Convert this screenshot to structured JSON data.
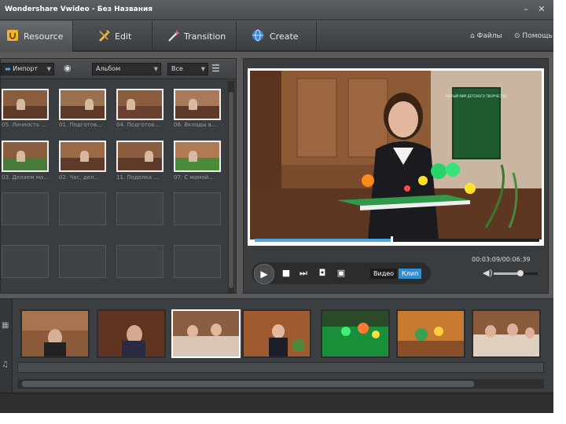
{
  "window": {
    "title": "Wondershare Vwideo - Без Названия",
    "minimize": "–",
    "close": "✕"
  },
  "tabs": [
    {
      "label": "Resource",
      "icon": "resource-icon",
      "active": true
    },
    {
      "label": "Edit",
      "icon": "edit-icon",
      "active": false
    },
    {
      "label": "Transition",
      "icon": "magic-wand-icon",
      "active": false
    },
    {
      "label": "Create",
      "icon": "globe-icon",
      "active": false
    }
  ],
  "toplinks": {
    "home": "Файлы",
    "help": "Помощь"
  },
  "toolbar": {
    "import_label": "Импорт",
    "album_label": "Альбом",
    "filter_label": "Все"
  },
  "media_items": [
    {
      "caption": "05. Личность ..."
    },
    {
      "caption": "01. Подготов..."
    },
    {
      "caption": "04. Подготов..."
    },
    {
      "caption": "06. Вклады в..."
    },
    {
      "caption": "03. Делаем ма..."
    },
    {
      "caption": "02. Час, дел..."
    },
    {
      "caption": "11. Поделка ..."
    },
    {
      "caption": "07. С мамой..."
    }
  ],
  "player": {
    "time": "00:03:09/00:06:39",
    "progress": 0.48,
    "volume": 0.6,
    "mode_video": "Видео",
    "mode_clip": "Клип",
    "accent": "#2d8fd4"
  },
  "scene": {
    "board_text": "МИЛЫЙ МИР ДЕТСКОГО ТВОРЧЕСТВА"
  },
  "timeline": {
    "clip_count": 7,
    "selected_clip": 2
  }
}
